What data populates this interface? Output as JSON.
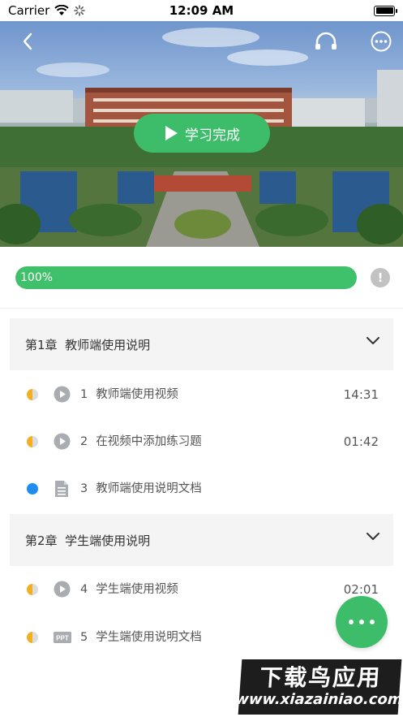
{
  "status_bar": {
    "carrier": "Carrier",
    "time": "12:09 AM"
  },
  "hero": {
    "complete_label": "学习完成"
  },
  "progress": {
    "label": "100%",
    "value": 1.0,
    "info_symbol": "!"
  },
  "chapters": [
    {
      "title": "第1章  教师端使用说明",
      "lessons": [
        {
          "num": "1",
          "title": "教师端使用视频",
          "duration": "14:31",
          "type": "video",
          "status": "half"
        },
        {
          "num": "2",
          "title": "在视频中添加练习题",
          "duration": "01:42",
          "type": "video",
          "status": "half"
        },
        {
          "num": "3",
          "title": "教师端使用说明文档",
          "duration": "",
          "type": "document",
          "status": "full"
        }
      ]
    },
    {
      "title": "第2章  学生端使用说明",
      "lessons": [
        {
          "num": "4",
          "title": "学生端使用视频",
          "duration": "02:01",
          "type": "video",
          "status": "half"
        },
        {
          "num": "5",
          "title": "学生端使用说明文档",
          "duration": "",
          "type": "ppt",
          "status": "half"
        }
      ]
    }
  ],
  "ppt_badge": "PPT",
  "watermark": {
    "title": "下载鸟应用",
    "url": "www.xiazainiao.com"
  },
  "colors": {
    "accent": "#3dbd6a",
    "progress": "#3fc06b",
    "status_half": "#f0b020",
    "status_full": "#1e8cf0"
  }
}
